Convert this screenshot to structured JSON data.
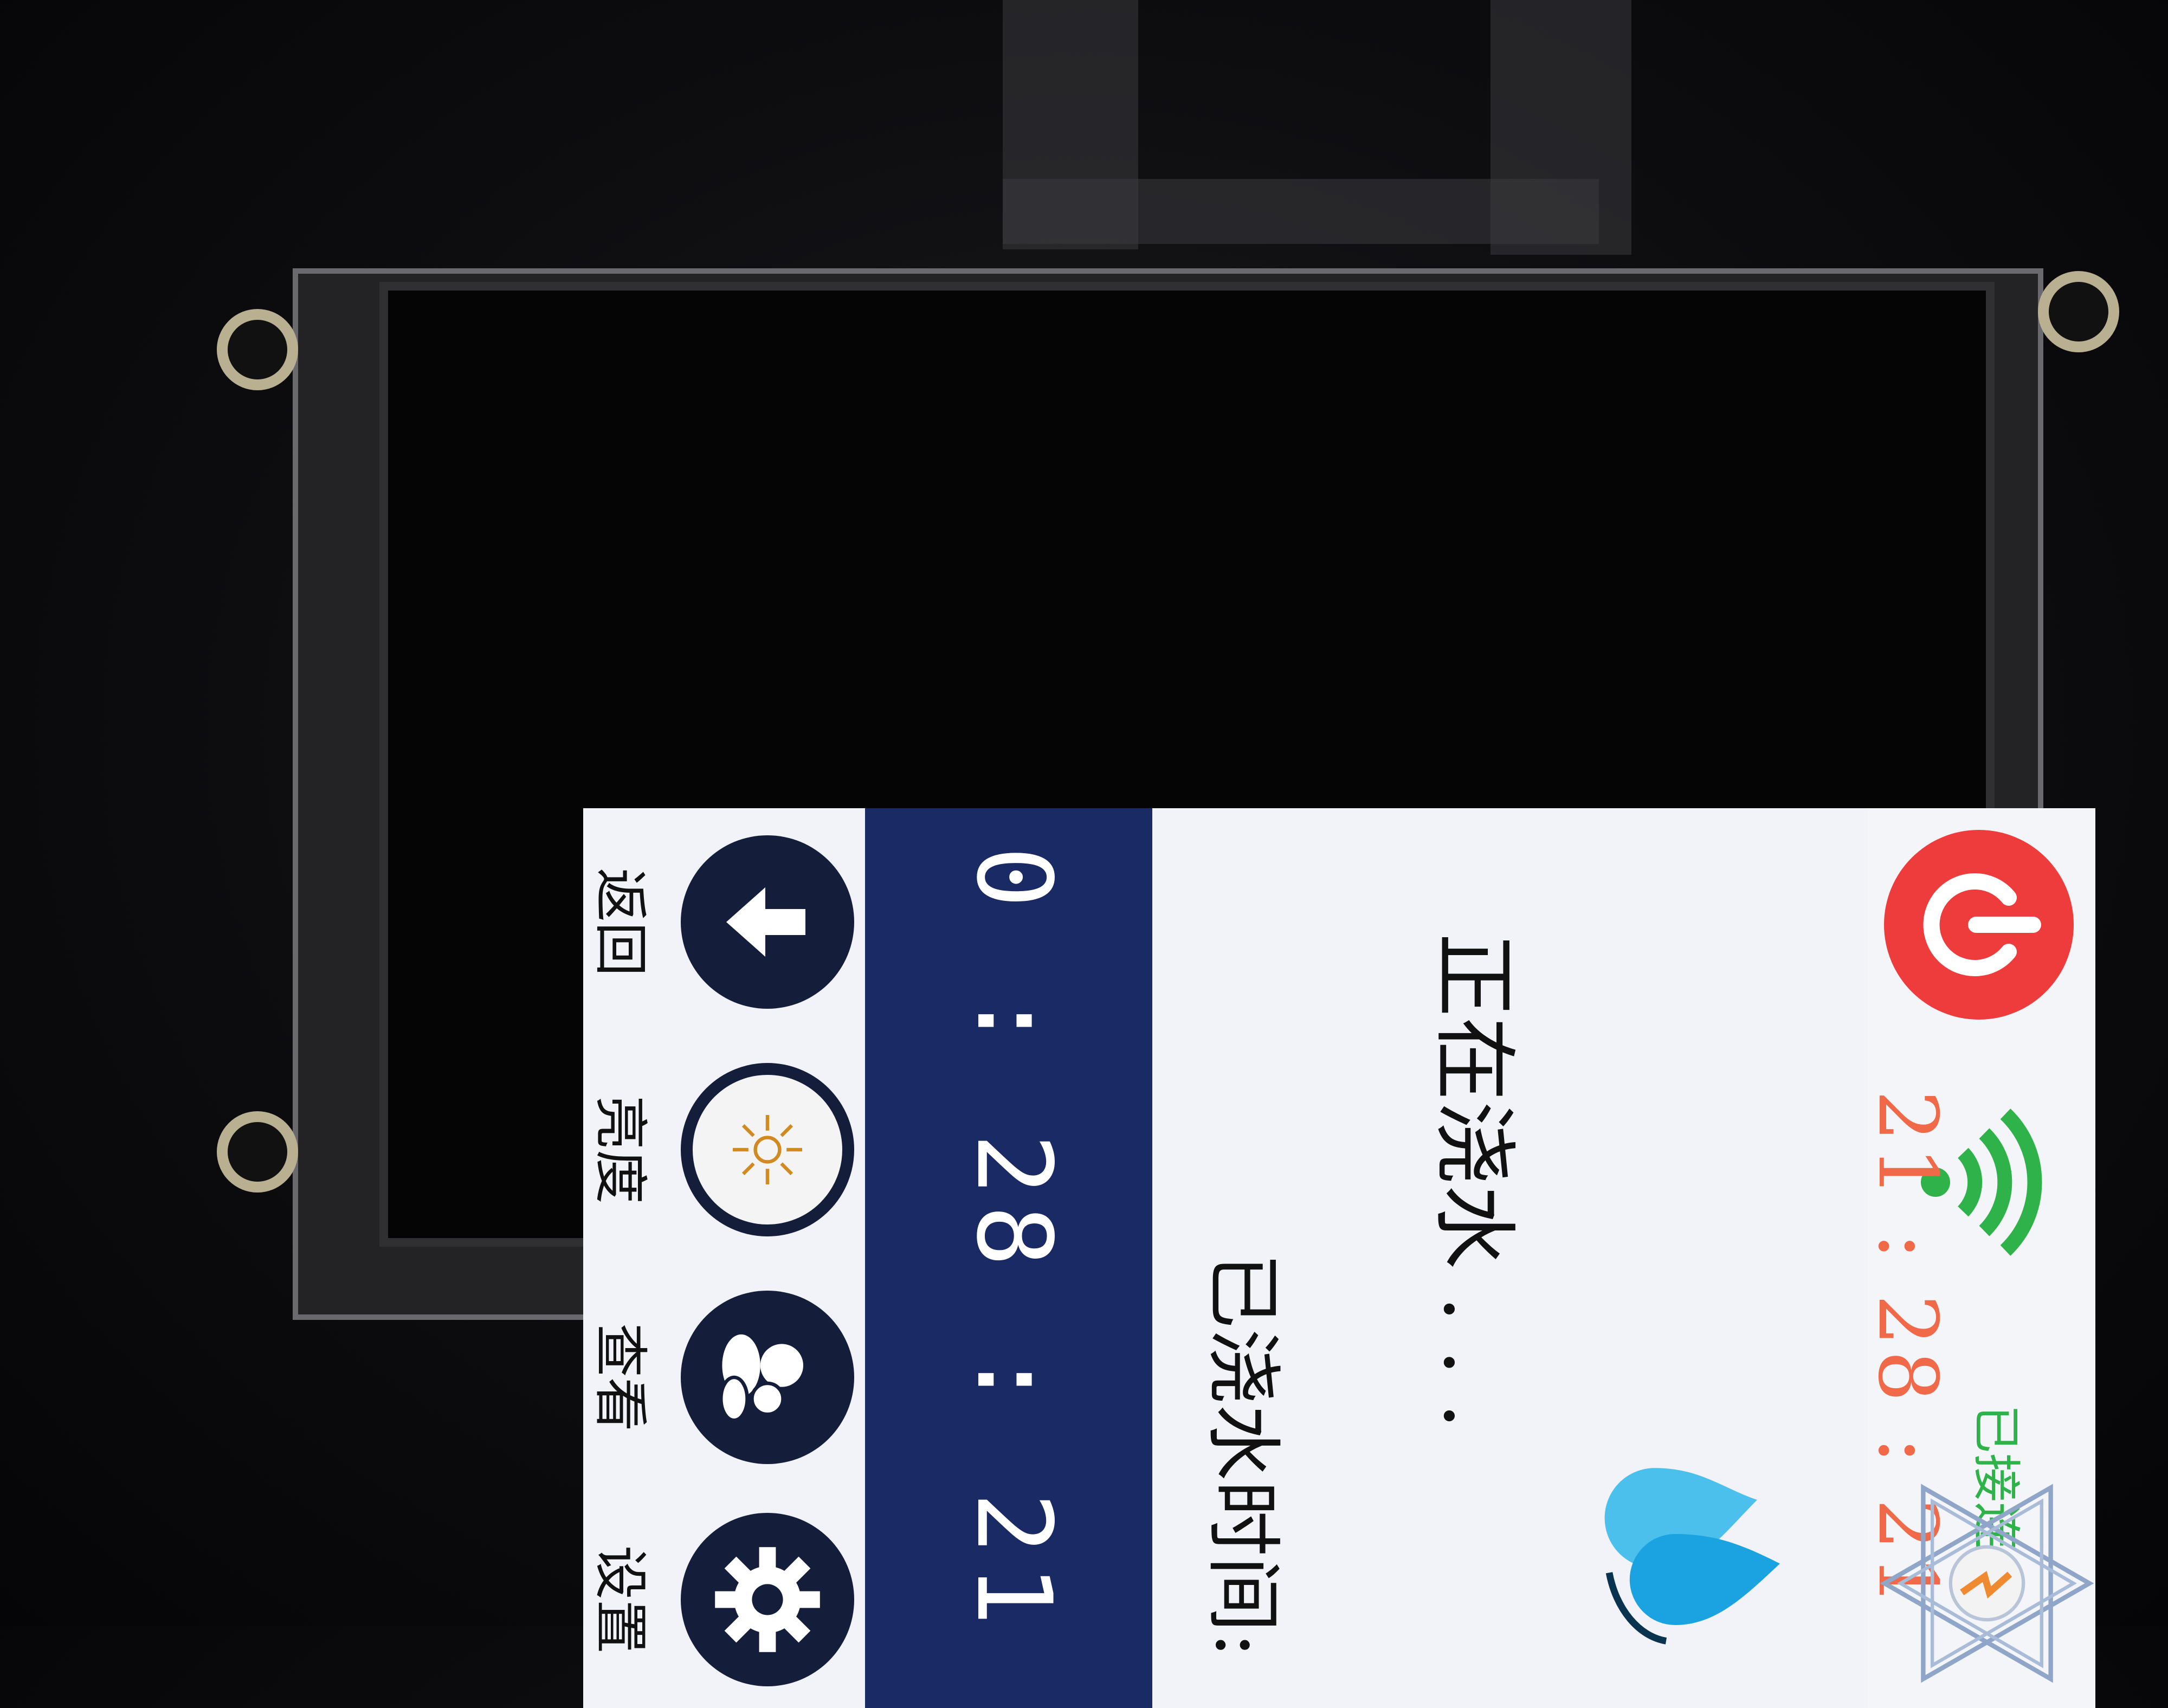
{
  "header": {
    "clock": "21 : 28 : 21",
    "connection_status": "已接连",
    "power_icon": "power-icon",
    "wifi_icon": "wifi-icon",
    "emblem_icon": "emblem-icon"
  },
  "main": {
    "status_text": "正在浇水 . . .",
    "drop_icon": "water-drop-icon",
    "elapsed_label": "已浇水时间:",
    "elapsed_time": "0 : 28 : 21"
  },
  "nav": {
    "items": [
      {
        "label": "返回",
        "icon": "down-arrow-icon"
      },
      {
        "label": "亮度",
        "icon": "brightness-icon"
      },
      {
        "label": "查看",
        "icon": "view-icon"
      },
      {
        "label": "设置",
        "icon": "gear-icon"
      }
    ]
  },
  "colors": {
    "timer_band": "#1a2a64",
    "clock": "#f06a4a",
    "connected": "#2fb24a",
    "power": "#ee3b3b",
    "drop": "#1aa3e0"
  }
}
